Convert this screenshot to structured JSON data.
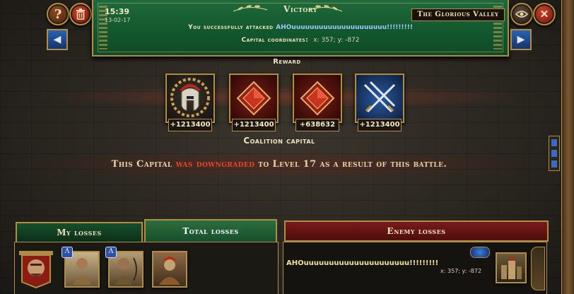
{
  "header": {
    "time": "15:39",
    "date": "13-02-17",
    "title": "Victory",
    "attack_prefix": "You successfully attacked ",
    "target_name": "AHOuuuuuuuuuuuuuuuuuuuuu!!!!!!!!!",
    "coords_label": "Capital coordinates:",
    "coords_value": "x: 357; y: -872",
    "location": "The Glorious Valley"
  },
  "buttons": {
    "help": "?",
    "close": "✕"
  },
  "reward": {
    "title": "Reward",
    "items": [
      {
        "icon": "spartan-helmet-laurel-icon",
        "value": "+1213400"
      },
      {
        "icon": "red-gem-icon",
        "value": "+1213400"
      },
      {
        "icon": "red-gem-icon",
        "value": "+638632"
      },
      {
        "icon": "crossed-swords-icon",
        "value": "+1213400"
      }
    ]
  },
  "capital": {
    "title": "Coalition capital",
    "msg_prefix": "This Capital ",
    "msg_highlight": "was downgraded",
    "msg_suffix": " to Level 17 as a result of this battle."
  },
  "tabs": {
    "my_losses": "My losses",
    "total_losses": "Total losses",
    "enemy_losses": "Enemy losses"
  },
  "enemy": {
    "name": "AHOuuuuuuuuuuuuuuuuuuuuu!!!!!!!!!",
    "coords": "x: 357; y: -872"
  },
  "colors": {
    "banner_green": "#135a2f",
    "gold": "#b08d45",
    "highlight_red": "#e8452c",
    "link_blue": "#9fc8ff"
  }
}
